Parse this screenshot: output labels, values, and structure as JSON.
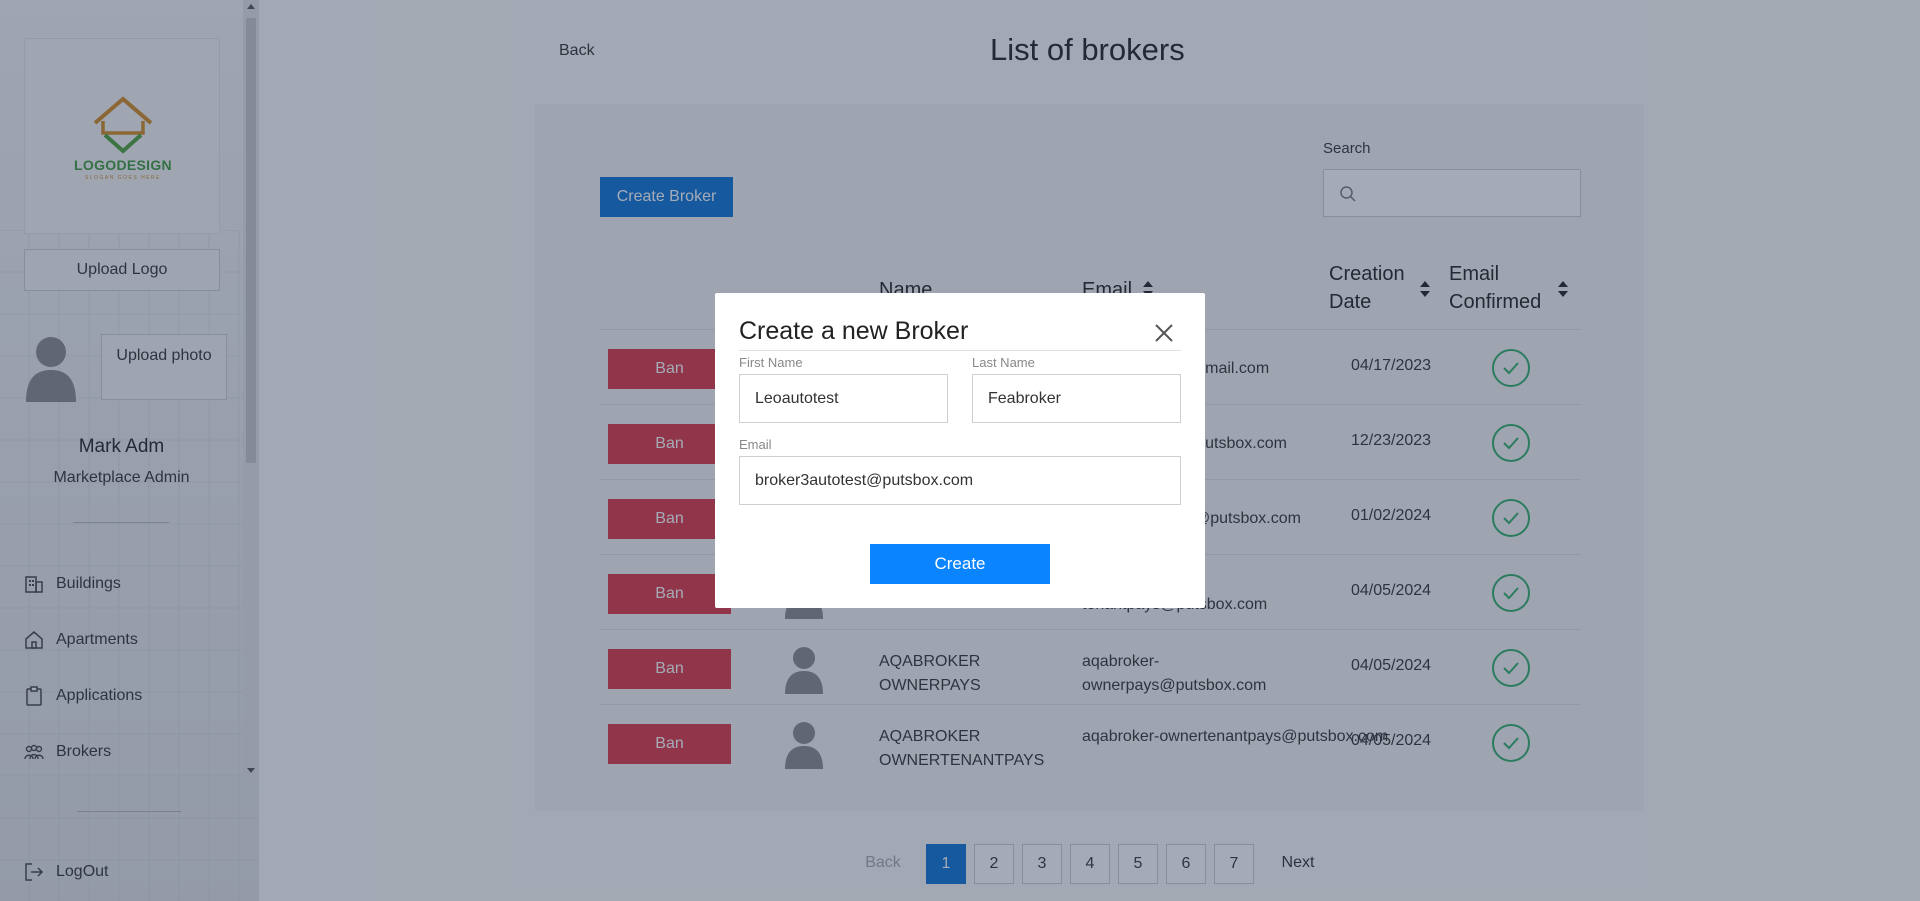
{
  "sidebar": {
    "logo": {
      "text": "LOGODESIGN",
      "subtext": "SLOGAN GOES HERE"
    },
    "upload_logo_label": "Upload Logo",
    "upload_photo_label": "Upload photo",
    "user_name": "Mark Adm",
    "user_role": "Marketplace Admin",
    "nav": [
      {
        "label": "Buildings",
        "icon": "building-icon"
      },
      {
        "label": "Apartments",
        "icon": "home-icon"
      },
      {
        "label": "Applications",
        "icon": "clipboard-icon"
      },
      {
        "label": "Brokers",
        "icon": "people-icon"
      }
    ],
    "logout_label": "LogOut"
  },
  "header": {
    "back_label": "Back",
    "title": "List of brokers"
  },
  "toolbar": {
    "create_broker_label": "Create Broker",
    "search_label": "Search",
    "search_value": ""
  },
  "table": {
    "columns": [
      "Name",
      "Email",
      "Creation Date",
      "Email Confirmed"
    ],
    "ban_label": "Ban",
    "rows": [
      {
        "name": "",
        "email": "@gmail.com",
        "date": "04/17/2023",
        "confirmed": true
      },
      {
        "name": "",
        "email": "@putsbox.com",
        "date": "12/23/2023",
        "confirmed": true
      },
      {
        "name": "",
        "email": "@putsbox.com",
        "date": "01/02/2024",
        "confirmed": true
      },
      {
        "name": "",
        "email": "tenantpays@putsbox.com",
        "date": "04/05/2024",
        "confirmed": true
      },
      {
        "name": "AQABROKER OWNERPAYS",
        "email": "aqabroker-ownerpays@putsbox.com",
        "date": "04/05/2024",
        "confirmed": true
      },
      {
        "name": "AQABROKER OWNERTENANTPAYS",
        "email": "aqabroker-ownertenantpays@putsbox.com",
        "date": "04/05/2024",
        "confirmed": true
      }
    ]
  },
  "pagination": {
    "back_label": "Back",
    "next_label": "Next",
    "pages": [
      "1",
      "2",
      "3",
      "4",
      "5",
      "6",
      "7"
    ],
    "current": "1"
  },
  "modal": {
    "title": "Create a new Broker",
    "first_name_label": "First Name",
    "first_name_value": "Leoautotest",
    "last_name_label": "Last Name",
    "last_name_value": "Feabroker",
    "email_label": "Email",
    "email_value": "broker3autotest@putsbox.com",
    "create_label": "Create"
  },
  "colors": {
    "primary": "#0b73d8",
    "modal_button": "#0b84ff",
    "ban": "#dc3545",
    "confirmed": "#2eae6a"
  }
}
